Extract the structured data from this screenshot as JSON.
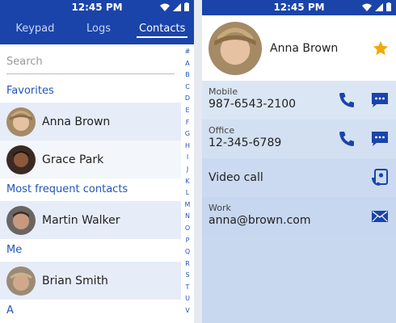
{
  "status": {
    "time": "12:45 PM"
  },
  "tabs": [
    {
      "label": "Keypad"
    },
    {
      "label": "Logs"
    },
    {
      "label": "Contacts"
    }
  ],
  "search": {
    "placeholder": "Search"
  },
  "sections": {
    "favorites": "Favorites",
    "frequent": "Most frequent contacts",
    "me": "Me",
    "a": "A"
  },
  "contacts": {
    "anna": "Anna Brown",
    "grace": "Grace Park",
    "martin": "Martin Walker",
    "brian": "Brian Smith"
  },
  "index_letters": [
    "#",
    "A",
    "B",
    "C",
    "D",
    "E",
    "F",
    "G",
    "H",
    "I",
    "J",
    "K",
    "L",
    "M",
    "N",
    "O",
    "P",
    "Q",
    "R",
    "S",
    "T",
    "U",
    "V"
  ],
  "detail": {
    "name": "Anna Brown",
    "mobile_label": "Mobile",
    "mobile_value": "987-6543-2100",
    "office_label": "Office",
    "office_value": "12-345-6789",
    "video_call": "Video call",
    "work_label": "Work",
    "work_value": "anna@brown.com"
  },
  "colors": {
    "accent": "#1a44a9",
    "star": "#f2a900"
  }
}
